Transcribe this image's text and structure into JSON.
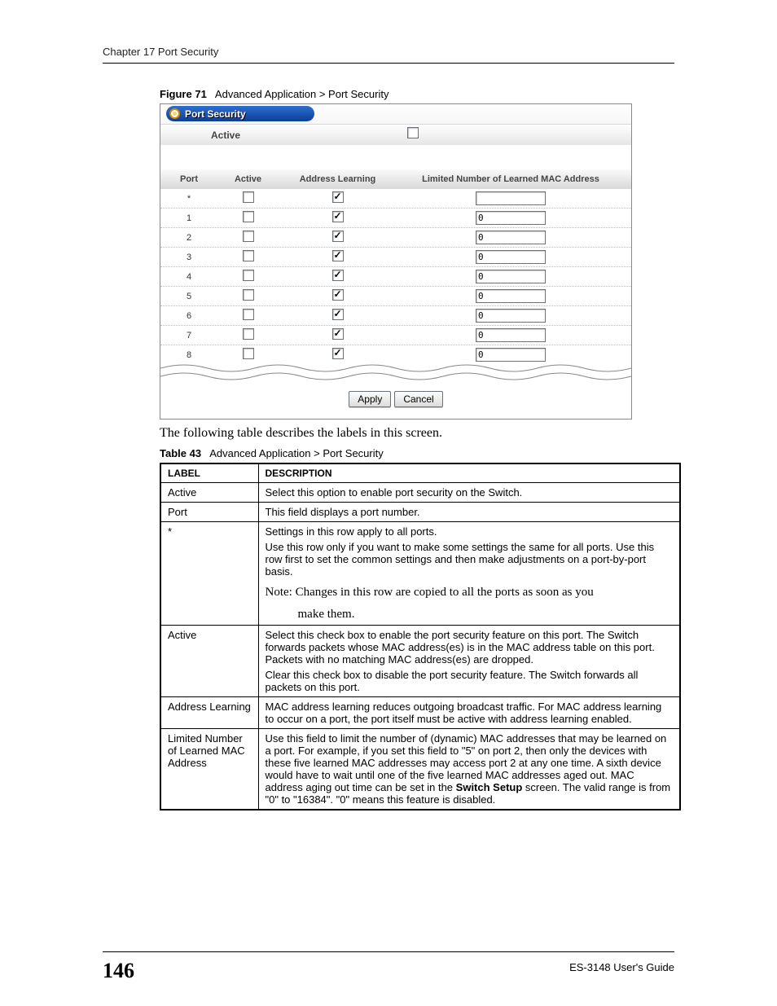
{
  "header": {
    "chapter": "Chapter 17 Port Security"
  },
  "figure": {
    "label": "Figure 71",
    "title": "Advanced Application > Port Security"
  },
  "ui": {
    "tab": "Port Security",
    "globalActive": {
      "label": "Active",
      "checked": false
    },
    "columns": {
      "port": "Port",
      "active": "Active",
      "learn": "Address Learning",
      "limit": "Limited Number of Learned MAC Address"
    },
    "rows": [
      {
        "port": "*",
        "active": false,
        "learn": true,
        "limit": ""
      },
      {
        "port": "1",
        "active": false,
        "learn": true,
        "limit": "0"
      },
      {
        "port": "2",
        "active": false,
        "learn": true,
        "limit": "0"
      },
      {
        "port": "3",
        "active": false,
        "learn": true,
        "limit": "0"
      },
      {
        "port": "4",
        "active": false,
        "learn": true,
        "limit": "0"
      },
      {
        "port": "5",
        "active": false,
        "learn": true,
        "limit": "0"
      },
      {
        "port": "6",
        "active": false,
        "learn": true,
        "limit": "0"
      },
      {
        "port": "7",
        "active": false,
        "learn": true,
        "limit": "0"
      },
      {
        "port": "8",
        "active": false,
        "learn": true,
        "limit": "0"
      }
    ],
    "buttons": {
      "apply": "Apply",
      "cancel": "Cancel"
    }
  },
  "bodyText": "The following table describes the labels in this screen.",
  "table": {
    "label": "Table 43",
    "title": "Advanced Application > Port Security",
    "head": {
      "c1": "LABEL",
      "c2": "DESCRIPTION"
    },
    "rows": [
      {
        "label": "Active",
        "desc": "Select this option to enable port security on the Switch."
      },
      {
        "label": "Port",
        "desc": "This field displays a port number."
      },
      {
        "label": "*",
        "desc": "Settings in this row apply to all ports.\nUse this row only if you want to make some settings the same for all ports. Use this row first to set the common settings and then make adjustments on a port-by-port basis.",
        "note": "Note: Changes in this row are copied to all the ports as soon as you",
        "note2": "make them."
      },
      {
        "label": "Active",
        "desc": "Select this check box to enable the port security feature on this port. The Switch forwards packets whose MAC address(es) is in the MAC address table on this port. Packets with no matching MAC address(es) are dropped.\nClear this check box to disable the port security feature. The Switch forwards all packets on this port."
      },
      {
        "label": "Address Learning",
        "desc": "MAC address learning reduces outgoing broadcast traffic. For MAC address learning to occur on a port, the port itself must be active with address learning enabled."
      },
      {
        "label": "Limited Number of Learned MAC Address",
        "desc": "Use this field to limit the number of (dynamic) MAC addresses that may be learned on a port. For example, if you set this field to \"5\" on port 2, then only the devices with these five learned MAC addresses may access port 2 at any one time. A sixth device would have to wait until one of the five learned MAC addresses aged out. MAC address aging out time can be set in the Switch Setup screen. The valid range is from \"0\" to \"16384\". \"0\" means this feature is disabled.",
        "bold": "Switch Setup"
      }
    ]
  },
  "footer": {
    "page": "146",
    "guide": "ES-3148 User's Guide"
  }
}
